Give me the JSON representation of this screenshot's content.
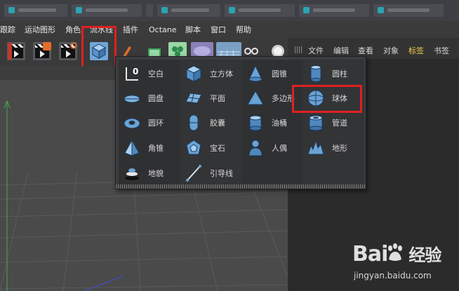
{
  "menubar": {
    "items": [
      "跟踪",
      "运动图形",
      "角色",
      "流水线",
      "插件",
      "Octane",
      "脚本",
      "窗口",
      "帮助"
    ]
  },
  "toolbar": {
    "buttons": [
      "render-view",
      "render-picture-viewer",
      "render-settings",
      "cube-object-menu",
      "pen",
      "subdivision",
      "deformer",
      "scene",
      "environment",
      "camera",
      "light"
    ]
  },
  "right_panel": {
    "tabs": [
      "文件",
      "编辑",
      "查看",
      "对象",
      "标签",
      "书签"
    ],
    "active_tab": "标签"
  },
  "popup": {
    "items": [
      {
        "label": "空白",
        "icon": "null-object-icon"
      },
      {
        "label": "圆盘",
        "icon": "disc-icon"
      },
      {
        "label": "圆环",
        "icon": "torus-icon"
      },
      {
        "label": "角锥",
        "icon": "pyramid-icon"
      },
      {
        "label": "地貌",
        "icon": "landscape-icon"
      },
      {
        "label": "立方体",
        "icon": "cube-icon"
      },
      {
        "label": "平面",
        "icon": "plane-icon"
      },
      {
        "label": "胶囊",
        "icon": "capsule-icon"
      },
      {
        "label": "宝石",
        "icon": "platonic-icon"
      },
      {
        "label": "引导线",
        "icon": "guide-icon"
      },
      {
        "label": "圆锥",
        "icon": "cone-icon"
      },
      {
        "label": "多边形",
        "icon": "polygon-icon"
      },
      {
        "label": "油桶",
        "icon": "oil-tank-icon"
      },
      {
        "label": "人偶",
        "icon": "figure-icon"
      },
      {
        "label": "圆柱",
        "icon": "cylinder-icon"
      },
      {
        "label": "球体",
        "icon": "sphere-icon"
      },
      {
        "label": "管道",
        "icon": "tube-icon"
      },
      {
        "label": "地形",
        "icon": "relief-icon"
      }
    ],
    "highlighted": "球体"
  },
  "colors": {
    "accent_blue": "#6fa6d8",
    "highlight_red": "#e02020",
    "active_tab": "#f2c94c"
  },
  "watermark": {
    "brand": "Bai",
    "brand2": "经验",
    "url": "jingyan.baidu.com"
  }
}
